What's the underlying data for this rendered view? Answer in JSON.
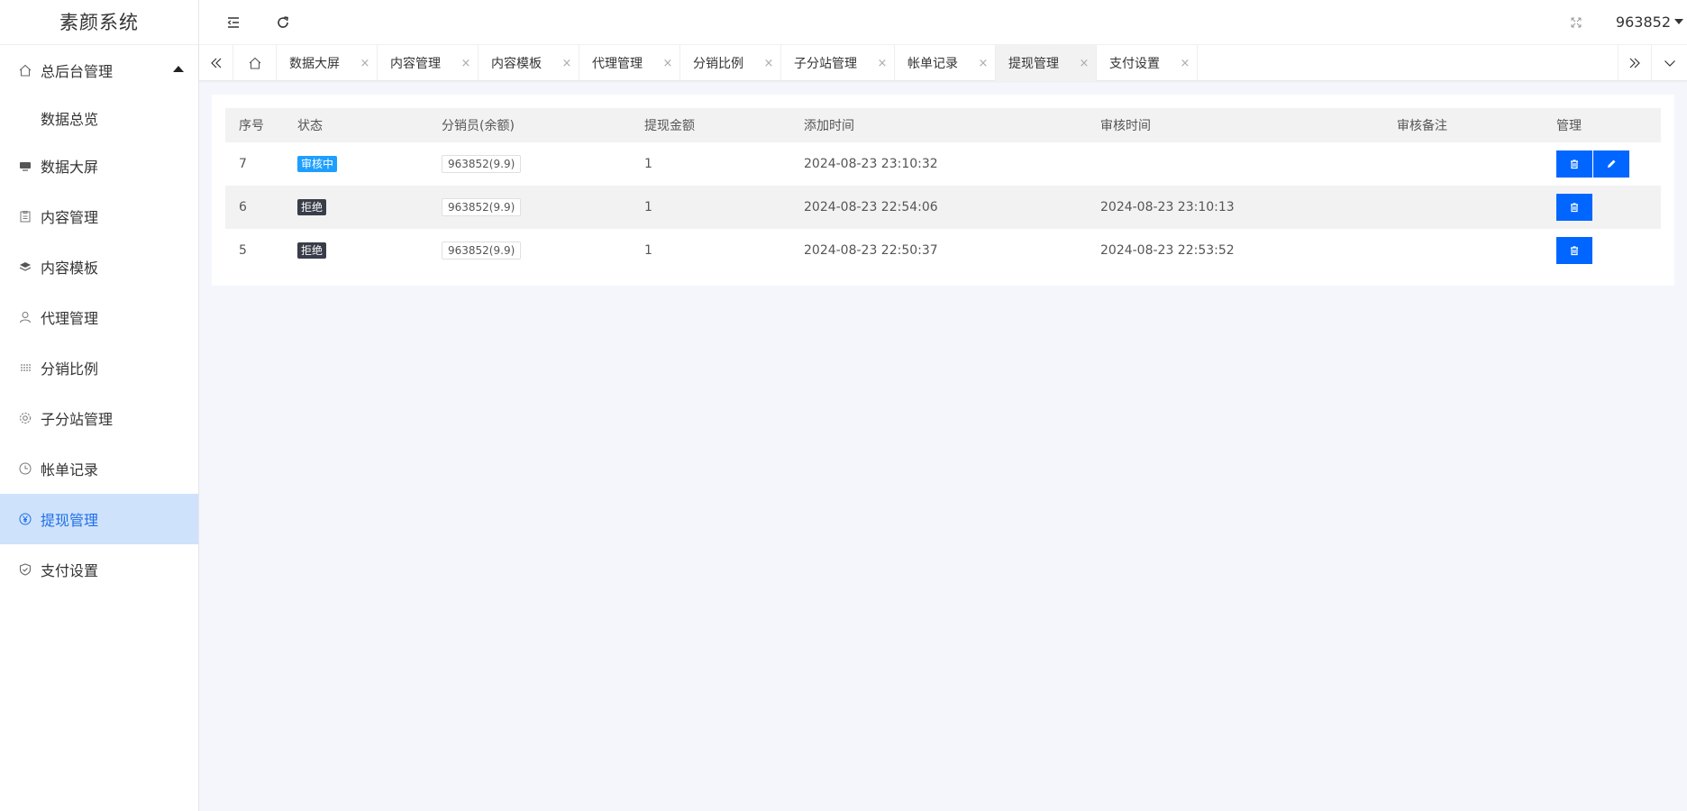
{
  "brand": {
    "title": "素颜系统"
  },
  "sidebar": {
    "group_label": "总后台管理",
    "sub_label": "数据总览",
    "items": [
      {
        "label": "数据大屏",
        "icon": "dashboard-icon"
      },
      {
        "label": "内容管理",
        "icon": "clipboard-icon"
      },
      {
        "label": "内容模板",
        "icon": "layers-icon"
      },
      {
        "label": "代理管理",
        "icon": "user-icon"
      },
      {
        "label": "分销比例",
        "icon": "grid-icon"
      },
      {
        "label": "子分站管理",
        "icon": "gear-icon"
      },
      {
        "label": "帐单记录",
        "icon": "clock-icon"
      },
      {
        "label": "提现管理",
        "icon": "yen-icon",
        "active": true
      },
      {
        "label": "支付设置",
        "icon": "shield-icon"
      }
    ]
  },
  "header": {
    "username": "963852"
  },
  "tabs": [
    {
      "label": "数据大屏"
    },
    {
      "label": "内容管理"
    },
    {
      "label": "内容模板"
    },
    {
      "label": "代理管理"
    },
    {
      "label": "分销比例"
    },
    {
      "label": "子分站管理"
    },
    {
      "label": "帐单记录"
    },
    {
      "label": "提现管理",
      "active": true
    },
    {
      "label": "支付设置"
    }
  ],
  "table": {
    "headers": [
      "序号",
      "状态",
      "分销员(余额)",
      "提现金额",
      "添加时间",
      "审核时间",
      "审核备注",
      "管理"
    ],
    "rows": [
      {
        "id": "7",
        "status": "审核中",
        "status_color": "#1e9fff",
        "agent": "963852(9.9)",
        "amount": "1",
        "added": "2024-08-23 23:10:32",
        "reviewed": "",
        "note": "",
        "editable": true
      },
      {
        "id": "6",
        "status": "拒绝",
        "status_color": "#393d49",
        "agent": "963852(9.9)",
        "amount": "1",
        "added": "2024-08-23 22:54:06",
        "reviewed": "2024-08-23 23:10:13",
        "note": "",
        "editable": false
      },
      {
        "id": "5",
        "status": "拒绝",
        "status_color": "#393d49",
        "agent": "963852(9.9)",
        "amount": "1",
        "added": "2024-08-23 22:50:37",
        "reviewed": "2024-08-23 22:53:52",
        "note": "",
        "editable": false
      }
    ]
  },
  "colors": {
    "accent": "#0066ff",
    "active_bg": "#cfe2fb",
    "active_text": "#1e6fe8"
  }
}
